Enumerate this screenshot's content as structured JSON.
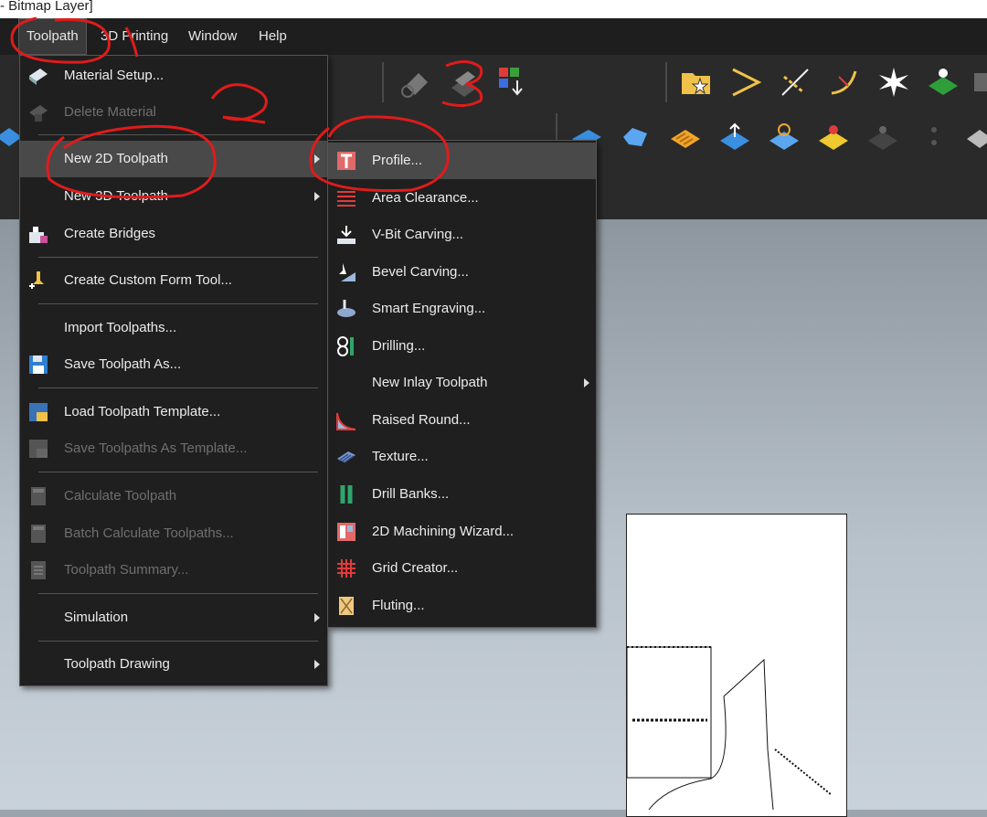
{
  "window": {
    "title_fragment": "- Bitmap Layer]"
  },
  "menubar": {
    "items": [
      {
        "label": "Toolpath"
      },
      {
        "label": "3D Printing"
      },
      {
        "label": "Window"
      },
      {
        "label": "Help"
      }
    ]
  },
  "toolpath_menu": {
    "items": [
      {
        "label": "Material Setup...",
        "icon": "material-setup-icon",
        "disabled": false
      },
      {
        "label": "Delete Material",
        "icon": "delete-material-icon",
        "disabled": true
      },
      {
        "label": "New 2D Toolpath",
        "icon": "",
        "disabled": false,
        "submenu": true,
        "highlighted": true
      },
      {
        "label": "New 3D Toolpath",
        "icon": "",
        "disabled": false,
        "submenu": true
      },
      {
        "label": "Create Bridges",
        "icon": "create-bridges-icon",
        "disabled": false
      },
      {
        "label": "Create Custom Form Tool...",
        "icon": "custom-form-tool-icon",
        "disabled": false
      },
      {
        "label": "Import Toolpaths...",
        "icon": "",
        "disabled": false
      },
      {
        "label": "Save Toolpath As...",
        "icon": "save-icon",
        "disabled": false
      },
      {
        "label": "Load Toolpath Template...",
        "icon": "load-template-icon",
        "disabled": false
      },
      {
        "label": "Save Toolpaths As Template...",
        "icon": "save-template-icon",
        "disabled": true
      },
      {
        "label": "Calculate Toolpath",
        "icon": "calculator-icon",
        "disabled": true
      },
      {
        "label": "Batch Calculate Toolpaths...",
        "icon": "batch-calculator-icon",
        "disabled": true
      },
      {
        "label": "Toolpath Summary...",
        "icon": "summary-icon",
        "disabled": true
      },
      {
        "label": "Simulation",
        "icon": "",
        "disabled": false,
        "submenu": true
      },
      {
        "label": "Toolpath Drawing",
        "icon": "",
        "disabled": false,
        "submenu": true
      }
    ]
  },
  "submenu_2d": {
    "items": [
      {
        "label": "Profile...",
        "icon": "profile-icon",
        "highlighted": true
      },
      {
        "label": "Area Clearance...",
        "icon": "area-clearance-icon"
      },
      {
        "label": "V-Bit Carving...",
        "icon": "vbit-carving-icon"
      },
      {
        "label": "Bevel Carving...",
        "icon": "bevel-carving-icon"
      },
      {
        "label": "Smart Engraving...",
        "icon": "smart-engraving-icon"
      },
      {
        "label": "Drilling...",
        "icon": "drilling-icon"
      },
      {
        "label": "New Inlay Toolpath",
        "icon": "",
        "submenu": true
      },
      {
        "label": "Raised Round...",
        "icon": "raised-round-icon"
      },
      {
        "label": "Texture...",
        "icon": "texture-icon"
      },
      {
        "label": "Drill Banks...",
        "icon": "drill-banks-icon"
      },
      {
        "label": "2D Machining Wizard...",
        "icon": "machining-wizard-icon"
      },
      {
        "label": "Grid Creator...",
        "icon": "grid-creator-icon"
      },
      {
        "label": "Fluting...",
        "icon": "fluting-icon"
      }
    ]
  },
  "annotations": {
    "labels": [
      "1",
      "2",
      "3"
    ],
    "color": "#e01b1b"
  },
  "colors": {
    "menu_bg": "#1f1f1f",
    "highlight": "#494949",
    "accent_red": "#e01b1b"
  }
}
